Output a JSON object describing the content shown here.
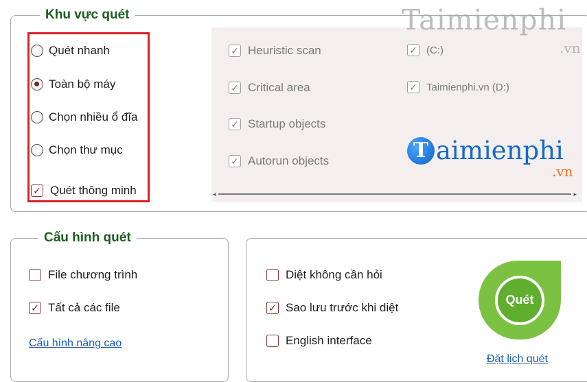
{
  "scan_area": {
    "title": "Khu vực quét",
    "modes": [
      {
        "label": "Quét nhanh",
        "selected": false
      },
      {
        "label": "Toàn bộ máy",
        "selected": true
      },
      {
        "label": "Chọn nhiều ổ đĩa",
        "selected": false
      },
      {
        "label": "Chọn thư mục",
        "selected": false
      }
    ],
    "smart_scan": {
      "label": "Quét thông minh",
      "checked": true
    },
    "options": [
      {
        "label": "Heuristic scan",
        "checked": true
      },
      {
        "label": "Critical area",
        "checked": true
      },
      {
        "label": "Startup objects",
        "checked": true
      },
      {
        "label": "Autorun objects",
        "checked": true
      }
    ],
    "drives": [
      {
        "label": "(C:)",
        "checked": true
      },
      {
        "label": "Taimienphi.vn (D:)",
        "checked": true
      }
    ]
  },
  "watermark": {
    "top_text": "Taimienphi",
    "top_suffix": ".vn",
    "logo_letter": "T",
    "logo_text": "aimienphi",
    "logo_suffix": ".vn"
  },
  "config": {
    "title": "Cấu hình quét",
    "options": [
      {
        "label": "File chương trình",
        "checked": false
      },
      {
        "label": "Tất cả các file",
        "checked": true
      }
    ],
    "advanced_link": "Cấu hình nâng cao"
  },
  "actions": {
    "options": [
      {
        "label": "Diệt không cần hỏi",
        "checked": false
      },
      {
        "label": "Sao lưu trước khi diệt",
        "checked": true
      },
      {
        "label": "English interface",
        "checked": false
      }
    ],
    "scan_button": "Quét",
    "schedule_link": "Đặt lịch quét"
  },
  "icons": {
    "check_mark": "✓"
  },
  "colors": {
    "title_green": "#1d5f1d",
    "highlight_red": "#d91f26",
    "scan_button_green": "#7cc242",
    "link_blue": "#1a5aa8"
  }
}
